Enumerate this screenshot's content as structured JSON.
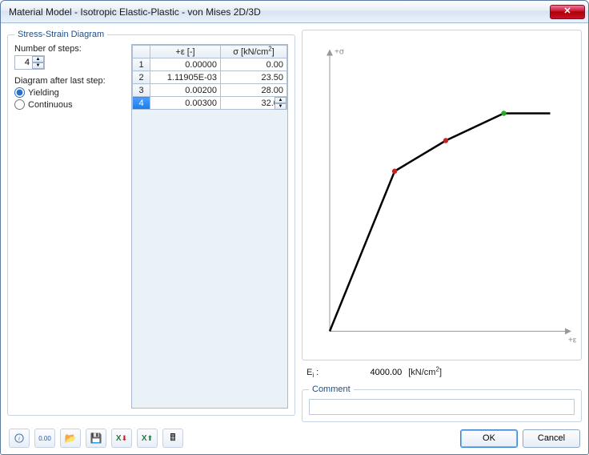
{
  "window": {
    "title": "Material Model - Isotropic Elastic-Plastic - von Mises 2D/3D"
  },
  "group": {
    "stress_strain": "Stress-Strain Diagram",
    "comment": "Comment"
  },
  "controls": {
    "steps_label": "Number of steps:",
    "steps_value": "4",
    "after_label": "Diagram after last step:",
    "yielding": "Yielding",
    "continuous": "Continuous"
  },
  "table": {
    "col_eps": "+ε [-]",
    "col_sigma": "σ [kN/cm²]",
    "rows": [
      {
        "n": "1",
        "eps": "0.00000",
        "sigma": "0.00"
      },
      {
        "n": "2",
        "eps": "1.11905E-03",
        "sigma": "23.50"
      },
      {
        "n": "3",
        "eps": "0.00200",
        "sigma": "28.00"
      },
      {
        "n": "4",
        "eps": "0.00300",
        "sigma": "32.00"
      }
    ],
    "selected": 3
  },
  "chart_data": {
    "type": "line",
    "xlabel": "+ε",
    "ylabel": "+σ",
    "x": [
      0,
      0.00111905,
      0.002,
      0.003,
      0.0038
    ],
    "y": [
      0,
      23.5,
      28.0,
      32.0,
      32.0
    ],
    "markers": [
      {
        "i": 1,
        "color": "#d02020"
      },
      {
        "i": 2,
        "color": "#d02020"
      },
      {
        "i": 3,
        "color": "#20b020"
      }
    ],
    "xlim": [
      0,
      0.004
    ],
    "ylim": [
      0,
      40
    ]
  },
  "e_row": {
    "label": "Eᵢ :",
    "value": "4000.00",
    "unit": "[kN/cm²]"
  },
  "comment": {
    "value": ""
  },
  "buttons": {
    "ok": "OK",
    "cancel": "Cancel"
  },
  "toolbar": {
    "help": "?",
    "num": "0.00",
    "open": "📂",
    "save": "💾",
    "excel_out": "⬇",
    "excel_in": "⬆",
    "calc": "🖩"
  }
}
